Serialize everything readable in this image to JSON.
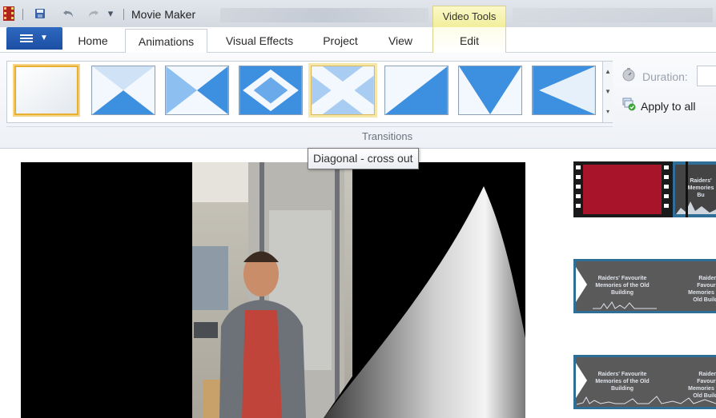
{
  "window": {
    "title": "Movie Maker",
    "contextual_tab": "Video Tools",
    "contextual_tab_color": "#f1ee9b"
  },
  "quick_access": {
    "icons": [
      "film-app-icon",
      "save-icon",
      "undo-icon",
      "redo-icon",
      "customize-dropdown-icon"
    ],
    "customize_glyph": "▾"
  },
  "tabs": [
    {
      "label": "Home",
      "active": false
    },
    {
      "label": "Animations",
      "active": true
    },
    {
      "label": "Visual Effects",
      "active": false
    },
    {
      "label": "Project",
      "active": false
    },
    {
      "label": "View",
      "active": false
    },
    {
      "label": "Edit",
      "active": false
    }
  ],
  "ribbon": {
    "group_label": "Transitions",
    "transitions": [
      {
        "icon": "no-transition-icon",
        "selected": true
      },
      {
        "icon": "bow-tie-horizontal-icon"
      },
      {
        "icon": "bow-tie-vertical-icon"
      },
      {
        "icon": "diamond-icon"
      },
      {
        "icon": "diagonal-cross-out-icon",
        "hover": true
      },
      {
        "icon": "diagonal-box-out-icon"
      },
      {
        "icon": "v-wipe-icon"
      },
      {
        "icon": "sweep-left-icon"
      }
    ],
    "duration_label": "Duration:",
    "apply_all_label": "Apply to all",
    "scroll_up_glyph": "▲",
    "scroll_down_glyph": "▼",
    "scroll_more_glyph": "▾"
  },
  "tooltip": {
    "text": "Diagonal - cross out"
  },
  "storyboard": {
    "title_clip_text": "Raiders' Favourite Memories of the Old Building",
    "clip_partial_text": "Raiders' Memories Bu",
    "accent_color": "#2f6f97"
  },
  "colors": {
    "file_button": "#1b4fa3",
    "selection_border": "#e8b030",
    "thumb_blue": "#3d8fe0"
  }
}
